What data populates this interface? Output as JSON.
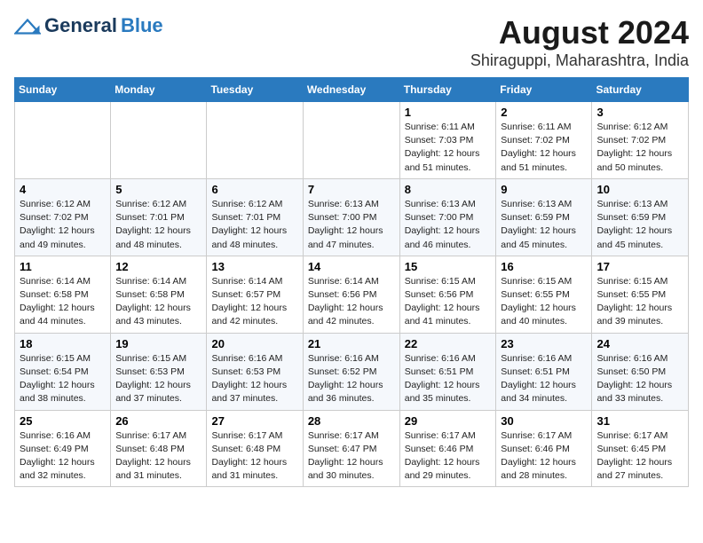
{
  "header": {
    "logo_general": "General",
    "logo_blue": "Blue",
    "title": "August 2024",
    "subtitle": "Shiraguppi, Maharashtra, India"
  },
  "days_of_week": [
    "Sunday",
    "Monday",
    "Tuesday",
    "Wednesday",
    "Thursday",
    "Friday",
    "Saturday"
  ],
  "weeks": [
    [
      {
        "day": "",
        "info": ""
      },
      {
        "day": "",
        "info": ""
      },
      {
        "day": "",
        "info": ""
      },
      {
        "day": "",
        "info": ""
      },
      {
        "day": "1",
        "info": "Sunrise: 6:11 AM\nSunset: 7:03 PM\nDaylight: 12 hours and 51 minutes."
      },
      {
        "day": "2",
        "info": "Sunrise: 6:11 AM\nSunset: 7:02 PM\nDaylight: 12 hours and 51 minutes."
      },
      {
        "day": "3",
        "info": "Sunrise: 6:12 AM\nSunset: 7:02 PM\nDaylight: 12 hours and 50 minutes."
      }
    ],
    [
      {
        "day": "4",
        "info": "Sunrise: 6:12 AM\nSunset: 7:02 PM\nDaylight: 12 hours and 49 minutes."
      },
      {
        "day": "5",
        "info": "Sunrise: 6:12 AM\nSunset: 7:01 PM\nDaylight: 12 hours and 48 minutes."
      },
      {
        "day": "6",
        "info": "Sunrise: 6:12 AM\nSunset: 7:01 PM\nDaylight: 12 hours and 48 minutes."
      },
      {
        "day": "7",
        "info": "Sunrise: 6:13 AM\nSunset: 7:00 PM\nDaylight: 12 hours and 47 minutes."
      },
      {
        "day": "8",
        "info": "Sunrise: 6:13 AM\nSunset: 7:00 PM\nDaylight: 12 hours and 46 minutes."
      },
      {
        "day": "9",
        "info": "Sunrise: 6:13 AM\nSunset: 6:59 PM\nDaylight: 12 hours and 45 minutes."
      },
      {
        "day": "10",
        "info": "Sunrise: 6:13 AM\nSunset: 6:59 PM\nDaylight: 12 hours and 45 minutes."
      }
    ],
    [
      {
        "day": "11",
        "info": "Sunrise: 6:14 AM\nSunset: 6:58 PM\nDaylight: 12 hours and 44 minutes."
      },
      {
        "day": "12",
        "info": "Sunrise: 6:14 AM\nSunset: 6:58 PM\nDaylight: 12 hours and 43 minutes."
      },
      {
        "day": "13",
        "info": "Sunrise: 6:14 AM\nSunset: 6:57 PM\nDaylight: 12 hours and 42 minutes."
      },
      {
        "day": "14",
        "info": "Sunrise: 6:14 AM\nSunset: 6:56 PM\nDaylight: 12 hours and 42 minutes."
      },
      {
        "day": "15",
        "info": "Sunrise: 6:15 AM\nSunset: 6:56 PM\nDaylight: 12 hours and 41 minutes."
      },
      {
        "day": "16",
        "info": "Sunrise: 6:15 AM\nSunset: 6:55 PM\nDaylight: 12 hours and 40 minutes."
      },
      {
        "day": "17",
        "info": "Sunrise: 6:15 AM\nSunset: 6:55 PM\nDaylight: 12 hours and 39 minutes."
      }
    ],
    [
      {
        "day": "18",
        "info": "Sunrise: 6:15 AM\nSunset: 6:54 PM\nDaylight: 12 hours and 38 minutes."
      },
      {
        "day": "19",
        "info": "Sunrise: 6:15 AM\nSunset: 6:53 PM\nDaylight: 12 hours and 37 minutes."
      },
      {
        "day": "20",
        "info": "Sunrise: 6:16 AM\nSunset: 6:53 PM\nDaylight: 12 hours and 37 minutes."
      },
      {
        "day": "21",
        "info": "Sunrise: 6:16 AM\nSunset: 6:52 PM\nDaylight: 12 hours and 36 minutes."
      },
      {
        "day": "22",
        "info": "Sunrise: 6:16 AM\nSunset: 6:51 PM\nDaylight: 12 hours and 35 minutes."
      },
      {
        "day": "23",
        "info": "Sunrise: 6:16 AM\nSunset: 6:51 PM\nDaylight: 12 hours and 34 minutes."
      },
      {
        "day": "24",
        "info": "Sunrise: 6:16 AM\nSunset: 6:50 PM\nDaylight: 12 hours and 33 minutes."
      }
    ],
    [
      {
        "day": "25",
        "info": "Sunrise: 6:16 AM\nSunset: 6:49 PM\nDaylight: 12 hours and 32 minutes."
      },
      {
        "day": "26",
        "info": "Sunrise: 6:17 AM\nSunset: 6:48 PM\nDaylight: 12 hours and 31 minutes."
      },
      {
        "day": "27",
        "info": "Sunrise: 6:17 AM\nSunset: 6:48 PM\nDaylight: 12 hours and 31 minutes."
      },
      {
        "day": "28",
        "info": "Sunrise: 6:17 AM\nSunset: 6:47 PM\nDaylight: 12 hours and 30 minutes."
      },
      {
        "day": "29",
        "info": "Sunrise: 6:17 AM\nSunset: 6:46 PM\nDaylight: 12 hours and 29 minutes."
      },
      {
        "day": "30",
        "info": "Sunrise: 6:17 AM\nSunset: 6:46 PM\nDaylight: 12 hours and 28 minutes."
      },
      {
        "day": "31",
        "info": "Sunrise: 6:17 AM\nSunset: 6:45 PM\nDaylight: 12 hours and 27 minutes."
      }
    ]
  ]
}
